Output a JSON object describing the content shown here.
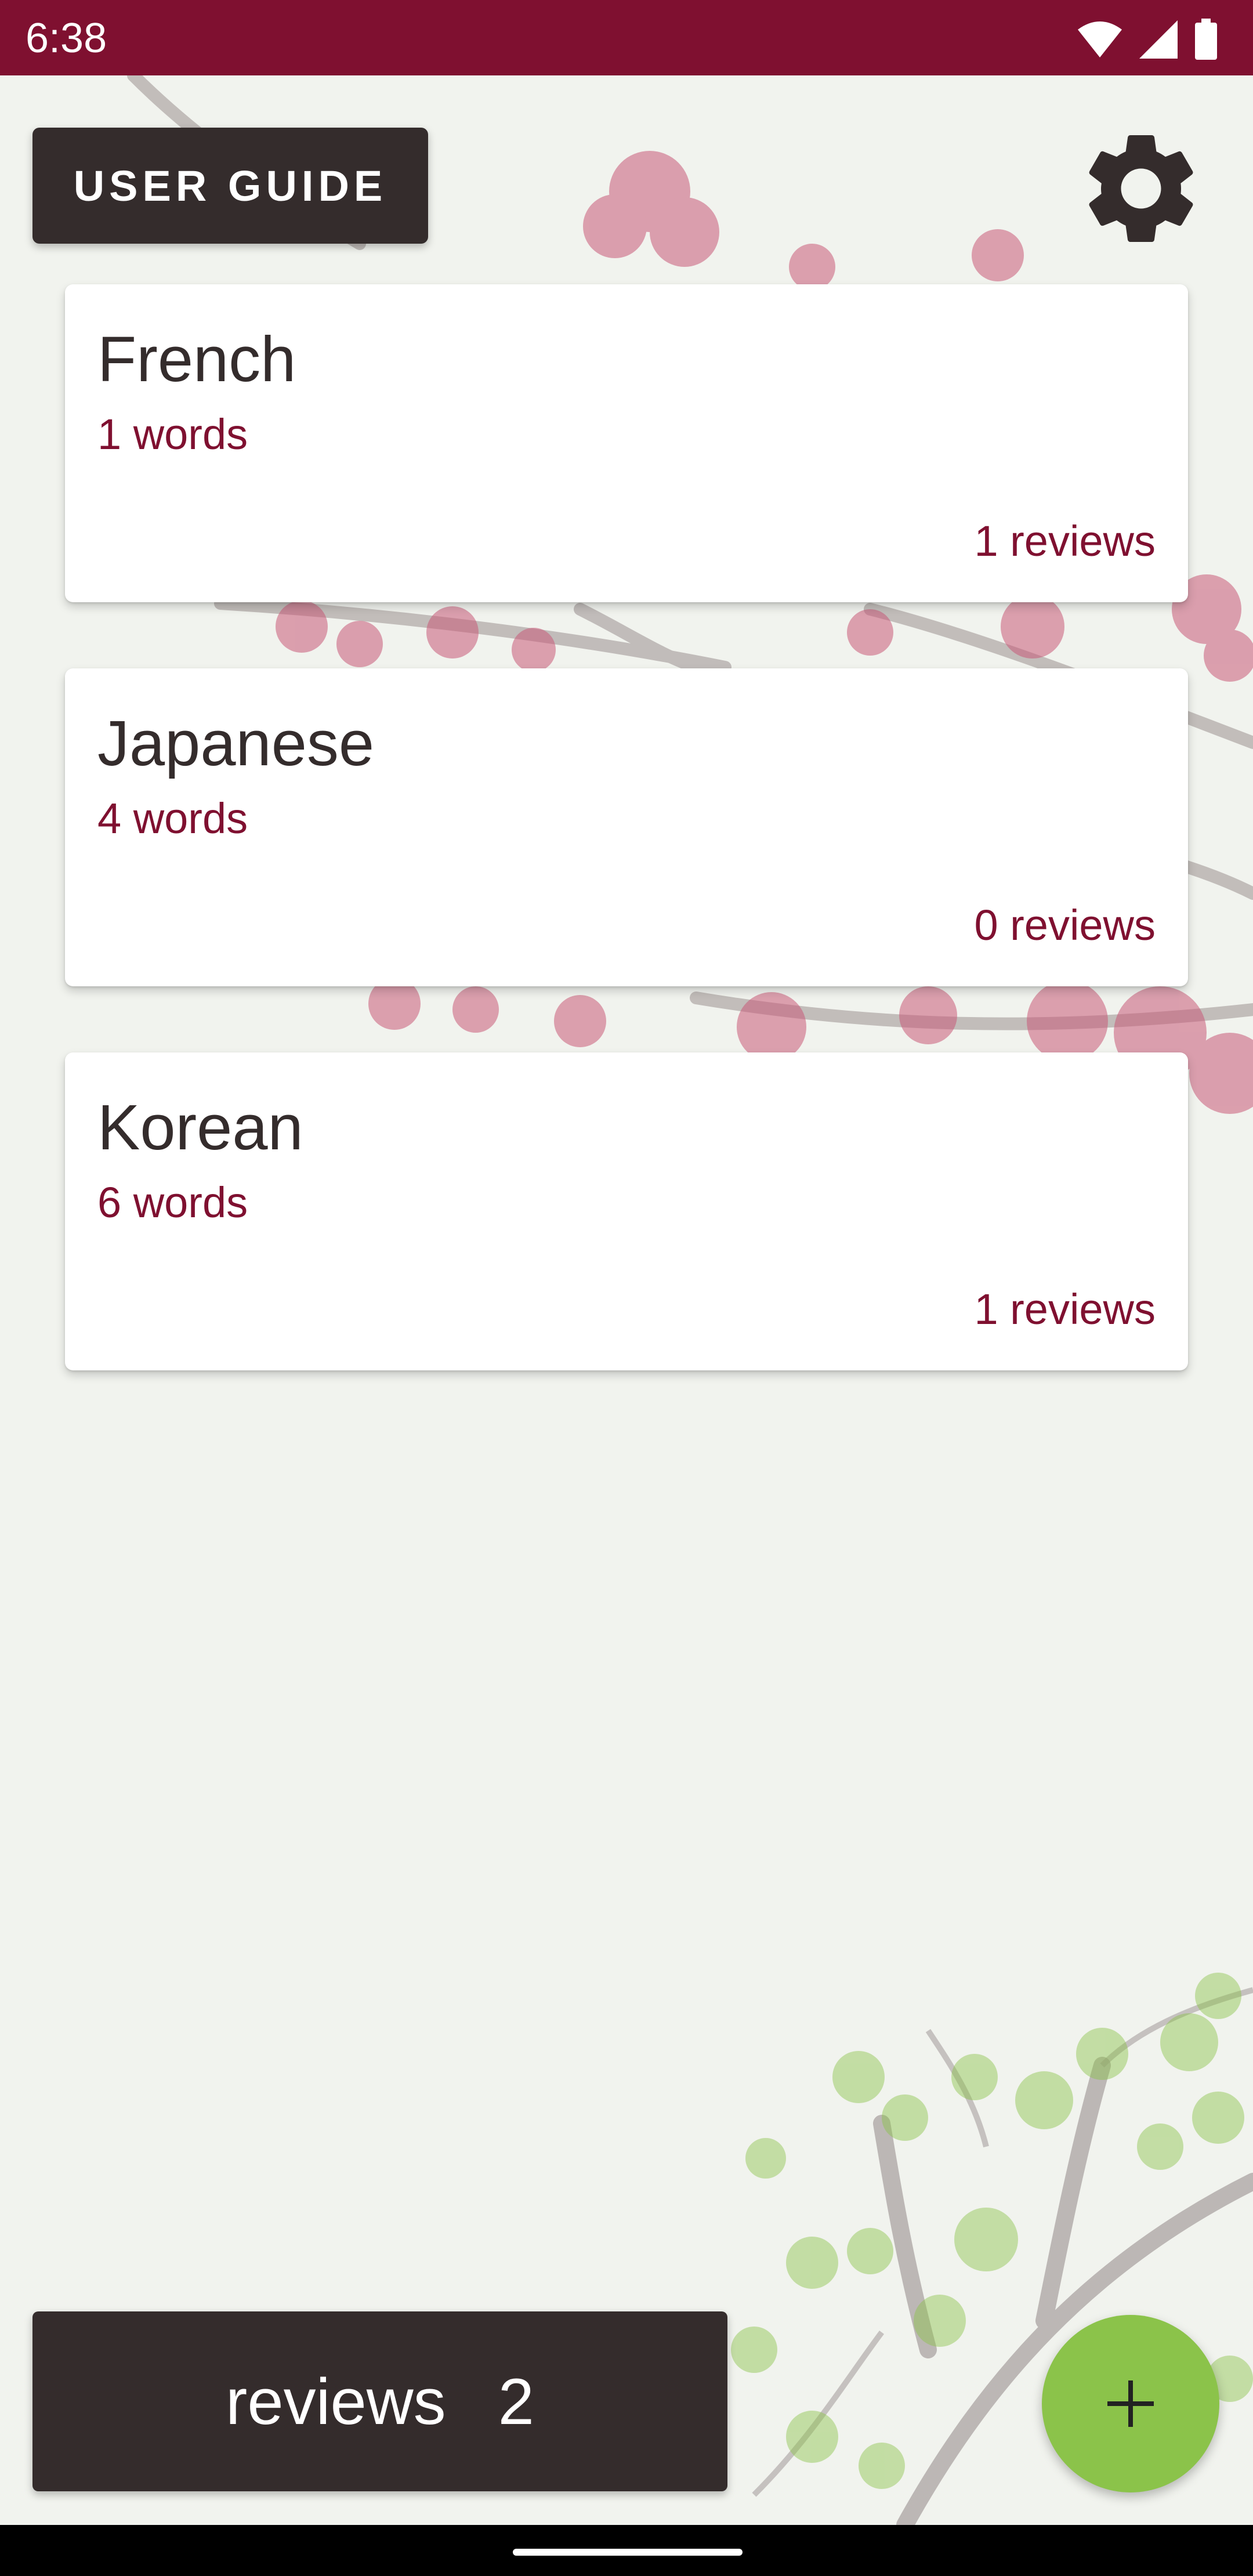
{
  "status_bar": {
    "time": "6:38",
    "icons": [
      "wifi-icon",
      "signal-icon",
      "battery-icon"
    ],
    "color": "#7f1030"
  },
  "toolbar": {
    "user_guide_label": "USER GUIDE",
    "settings_icon": "gear-icon"
  },
  "decks": [
    {
      "name": "French",
      "words": "1 words",
      "reviews": "1 reviews"
    },
    {
      "name": "Japanese",
      "words": "4 words",
      "reviews": "0 reviews"
    },
    {
      "name": "Korean",
      "words": "6 words",
      "reviews": "1 reviews"
    }
  ],
  "bottom": {
    "reviews_label": "reviews",
    "reviews_count": "2",
    "add_icon": "plus-icon"
  },
  "colors": {
    "accent": "#7f1030",
    "dark": "#342c2c",
    "fab": "#8bc34a",
    "background": "#f1f3ee"
  }
}
